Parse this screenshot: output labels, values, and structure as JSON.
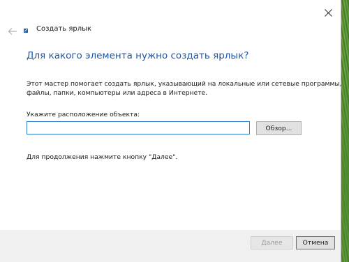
{
  "wizard": {
    "title": "Создать ярлык",
    "heading": "Для какого элемента нужно создать ярлык?",
    "description_lines": [
      "Этот мастер помогает создать ярлык, указывающий на локальные или сетевые программы,",
      "файлы, папки, компьютеры или адреса в Интернете."
    ],
    "location_label": "Укажите расположение объекта:",
    "location_value": "",
    "browse_label": "Обзор...",
    "hint": "Для продолжения нажмите кнопку \"Далее\".",
    "next_label": "Далее",
    "cancel_label": "Отмена"
  },
  "icons": {
    "close": "close-icon",
    "back": "back-arrow-icon",
    "wizard": "shortcut-wizard-icon"
  },
  "colors": {
    "heading": "#1f57a4",
    "input_border": "#2a7ad2",
    "footer_bg": "#f0f0f0",
    "desktop_grass": "#5e9a3a"
  },
  "state": {
    "next_enabled": false
  }
}
